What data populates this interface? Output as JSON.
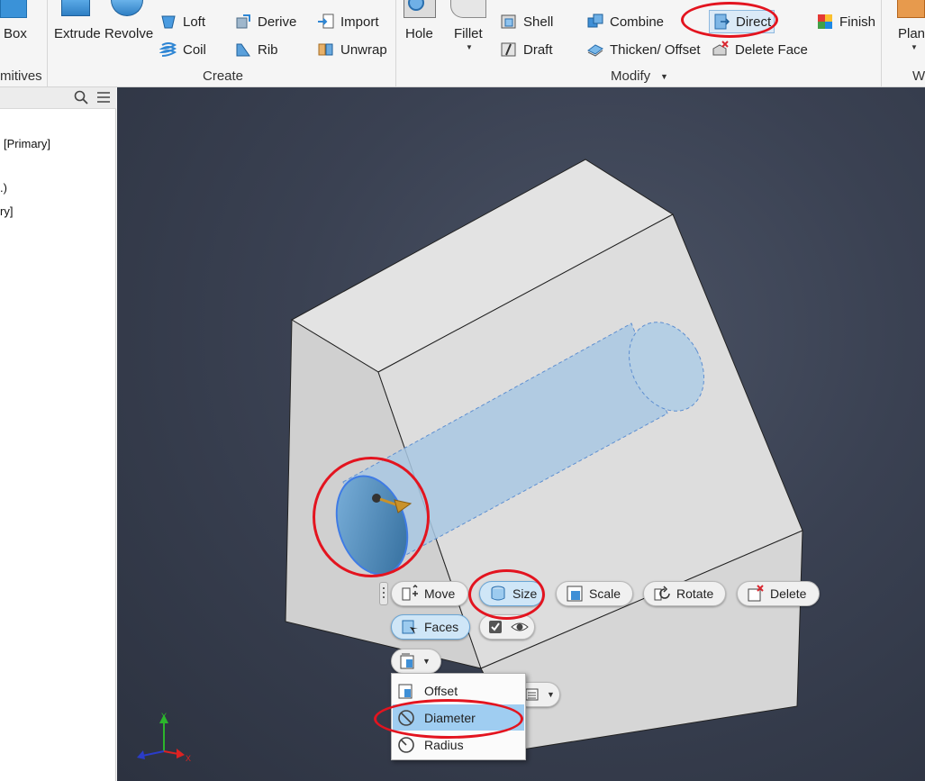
{
  "ribbon": {
    "primitives": {
      "box_label": "Box",
      "group_label": "mitives"
    },
    "create": {
      "extrude_label": "Extrude",
      "revolve_label": "Revolve",
      "loft_label": "Loft",
      "coil_label": "Coil",
      "derive_label": "Derive",
      "rib_label": "Rib",
      "import_label": "Import",
      "unwrap_label": "Unwrap",
      "group_label": "Create"
    },
    "modify": {
      "hole_label": "Hole",
      "fillet_label": "Fillet",
      "shell_label": "Shell",
      "draft_label": "Draft",
      "combine_label": "Combine",
      "thicken_label": "Thicken/ Offset",
      "direct_label": "Direct",
      "delete_face_label": "Delete Face",
      "finish_label": "Finish",
      "group_label": "Modify"
    },
    "work_features": {
      "plane_label": "Plane",
      "group_label": "W"
    }
  },
  "browser": {
    "tree": [
      "[Primary]",
      ".)",
      "ry]"
    ]
  },
  "mini_toolbar": {
    "move_label": "Move",
    "size_label": "Size",
    "scale_label": "Scale",
    "rotate_label": "Rotate",
    "delete_label": "Delete",
    "faces_label": "Faces",
    "size_options": [
      "Offset",
      "Diameter",
      "Radius"
    ],
    "selected_option": "Diameter"
  },
  "colors": {
    "annotation": "#e3141f",
    "highlight": "#9fcdf1",
    "viewport_bg": "#3a4152",
    "model_face": "#d8d8d8"
  }
}
